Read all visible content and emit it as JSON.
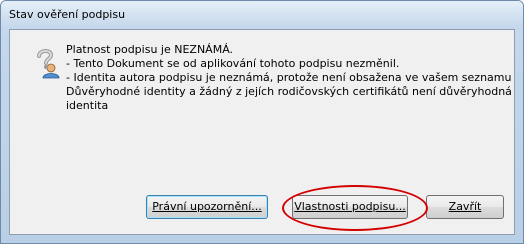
{
  "window": {
    "title": "Stav ověření podpisu"
  },
  "icon": "signature-unknown-question-icon",
  "message": {
    "lines": [
      "Platnost podpisu je NEZNÁMÁ.",
      "- Tento Dokument se od aplikování tohoto podpisu nezměnil.",
      "- Identita autora podpisu je neznámá, protože není obsažena ve vašem seznamu",
      "Důvěryhodné identity a žádný z jejích rodičovských certifikátů není důvěryhodná",
      "identita"
    ]
  },
  "buttons": {
    "legal_notice": "Právní upozornění...",
    "signature_properties": "Vlastnosti podpisu...",
    "close": "Zavřít"
  },
  "colors": {
    "annotation_ellipse": "#d40000",
    "dialog_background": "#f0f0f0"
  }
}
